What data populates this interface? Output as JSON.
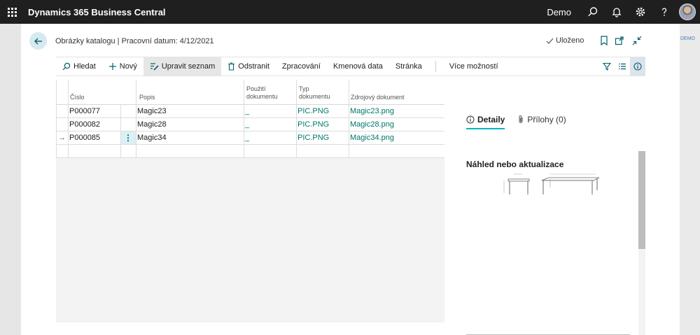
{
  "app": {
    "title": "Dynamics 365 Business Central",
    "company": "Demo",
    "bg_label": "DEMO"
  },
  "header": {
    "breadcrumb": "Obrázky katalogu | Pracovní datum: 4/12/2021",
    "saved_label": "Uloženo",
    "saved_icon": "check-icon"
  },
  "actions": {
    "search": "Hledat",
    "new": "Nový",
    "edit_list": "Upravit seznam",
    "delete": "Odstranit",
    "process": "Zpracování",
    "master_data": "Kmenová data",
    "page": "Stránka",
    "more": "Více možností"
  },
  "table": {
    "columns": {
      "number": "Číslo",
      "description": "Popis",
      "doc_use_1": "Použití",
      "doc_use_2": "dokumentu",
      "doc_type_1": "Typ",
      "doc_type_2": "dokumentu",
      "source_doc": "Zdrojový dokument"
    },
    "rows": [
      {
        "number": "P000077",
        "description": "Magic23",
        "doc_use": "_",
        "doc_type": "PIC.PNG",
        "source_doc": "Magic23.png"
      },
      {
        "number": "P000082",
        "description": "Magic28",
        "doc_use": "_",
        "doc_type": "PIC.PNG",
        "source_doc": "Magic28.png"
      },
      {
        "number": "P000085",
        "description": "Magic34",
        "doc_use": "_",
        "doc_type": "PIC.PNG",
        "source_doc": "Magic34.png"
      }
    ],
    "current_row_marker": "→",
    "row_menu": "⋮"
  },
  "factbox": {
    "tab_details": "Detaily",
    "tab_attachments": "Přílohy (0)",
    "title": "Náhled nebo aktualizace"
  },
  "colors": {
    "accent": "#00b7c3",
    "link": "#00786a",
    "appbar": "#1f1f1f"
  }
}
